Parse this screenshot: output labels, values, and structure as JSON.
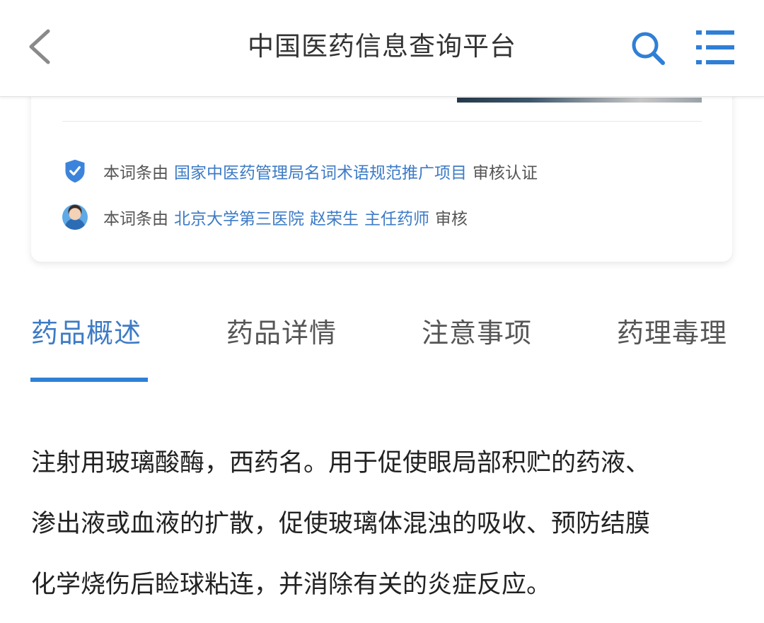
{
  "header": {
    "title": "中国医药信息查询平台"
  },
  "icons": {
    "back": "chevron-left-icon",
    "search": "search-icon",
    "menu": "menu-list-icon",
    "verified": "shield-check-icon"
  },
  "colors": {
    "accent": "#2f7fd6",
    "link": "#3d7bc6",
    "text": "#333333",
    "muted": "#555555"
  },
  "verification": {
    "row1": {
      "prefix": "本词条由",
      "link": "国家中医药管理局名词术语规范推广项目",
      "suffix": "审核认证"
    },
    "row2": {
      "prefix": "本词条由",
      "org_link": "北京大学第三医院",
      "person_link": "赵荣生",
      "title_link": "主任药师",
      "suffix": "审核"
    }
  },
  "tabs": [
    {
      "label": "药品概述",
      "active": true
    },
    {
      "label": "药品详情",
      "active": false
    },
    {
      "label": "注意事项",
      "active": false
    },
    {
      "label": "药理毒理",
      "active": false
    }
  ],
  "content": {
    "lines": [
      "注射用玻璃酸酶，西药名。用于促使眼局部积贮的药液、",
      "渗出液或血液的扩散，促使玻璃体混浊的吸收、预防结膜",
      "化学烧伤后睑球粘连，并消除有关的炎症反应。"
    ]
  }
}
